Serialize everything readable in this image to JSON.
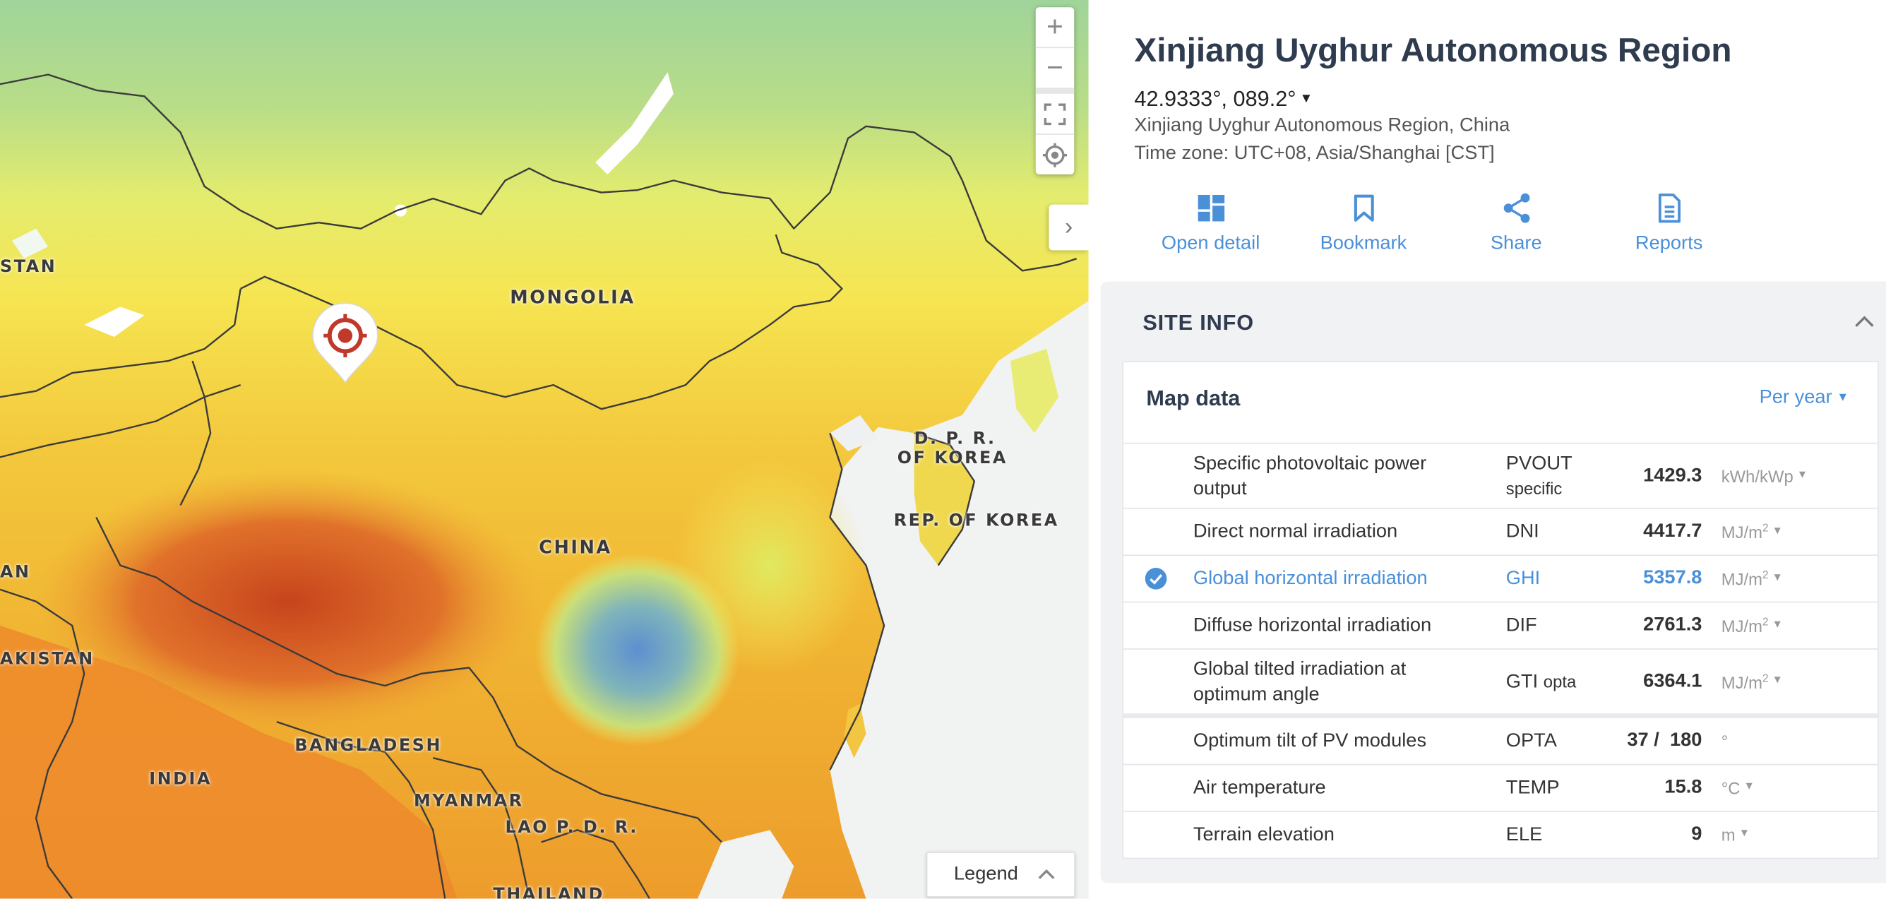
{
  "map": {
    "country_labels": [
      "STAN",
      "MONGOLIA",
      "D. P. R.",
      "OF KOREA",
      "REP. OF KOREA",
      "CHINA",
      "AN",
      "AKISTAN",
      "BANGLADESH",
      "INDIA",
      "MYANMAR",
      "LAO P. D. R.",
      "THAILAND"
    ],
    "zoom_in": "+",
    "zoom_out": "−",
    "legend_label": "Legend"
  },
  "site": {
    "title": "Xinjiang Uyghur Autonomous Region",
    "coordinates": "42.9333°, 089.2°",
    "location": "Xinjiang Uyghur Autonomous Region, China",
    "timezone": "Time zone: UTC+08, Asia/Shanghai [CST]"
  },
  "actions": [
    {
      "label": "Open detail",
      "icon": "dashboard-icon"
    },
    {
      "label": "Bookmark",
      "icon": "bookmark-icon"
    },
    {
      "label": "Share",
      "icon": "share-icon"
    },
    {
      "label": "Reports",
      "icon": "document-icon"
    }
  ],
  "site_info": {
    "header": "SITE INFO",
    "map_data_title": "Map data",
    "period": "Per year",
    "rows": [
      {
        "name": "Specific photovoltaic power output",
        "abbr": "PVOUT",
        "abbr_sub": "specific",
        "value": "1429.3",
        "unit": "kWh/kWp",
        "unit_sup": "",
        "active": false
      },
      {
        "name": "Direct normal irradiation",
        "abbr": "DNI",
        "abbr_sub": "",
        "value": "4417.7",
        "unit": "MJ/m",
        "unit_sup": "2",
        "active": false
      },
      {
        "name": "Global horizontal irradiation",
        "abbr": "GHI",
        "abbr_sub": "",
        "value": "5357.8",
        "unit": "MJ/m",
        "unit_sup": "2",
        "active": true
      },
      {
        "name": "Diffuse horizontal irradiation",
        "abbr": "DIF",
        "abbr_sub": "",
        "value": "2761.3",
        "unit": "MJ/m",
        "unit_sup": "2",
        "active": false
      },
      {
        "name": "Global tilted irradiation at optimum angle",
        "abbr": "GTI",
        "abbr_sub": "opta",
        "value": "6364.1",
        "unit": "MJ/m",
        "unit_sup": "2",
        "active": false
      },
      {
        "name": "Optimum tilt of PV modules",
        "abbr": "OPTA",
        "abbr_sub": "",
        "value": "37 /  180",
        "unit": "°",
        "unit_sup": "",
        "active": false
      },
      {
        "name": "Air temperature",
        "abbr": "TEMP",
        "abbr_sub": "",
        "value": "15.8",
        "unit": "°C",
        "unit_sup": "",
        "active": false
      },
      {
        "name": "Terrain elevation",
        "abbr": "ELE",
        "abbr_sub": "",
        "value": "9",
        "unit": "m",
        "unit_sup": "",
        "active": false
      }
    ]
  },
  "colors": {
    "accent": "#4a90d9",
    "title": "#2f3b4e",
    "pin": "#c0392b"
  }
}
